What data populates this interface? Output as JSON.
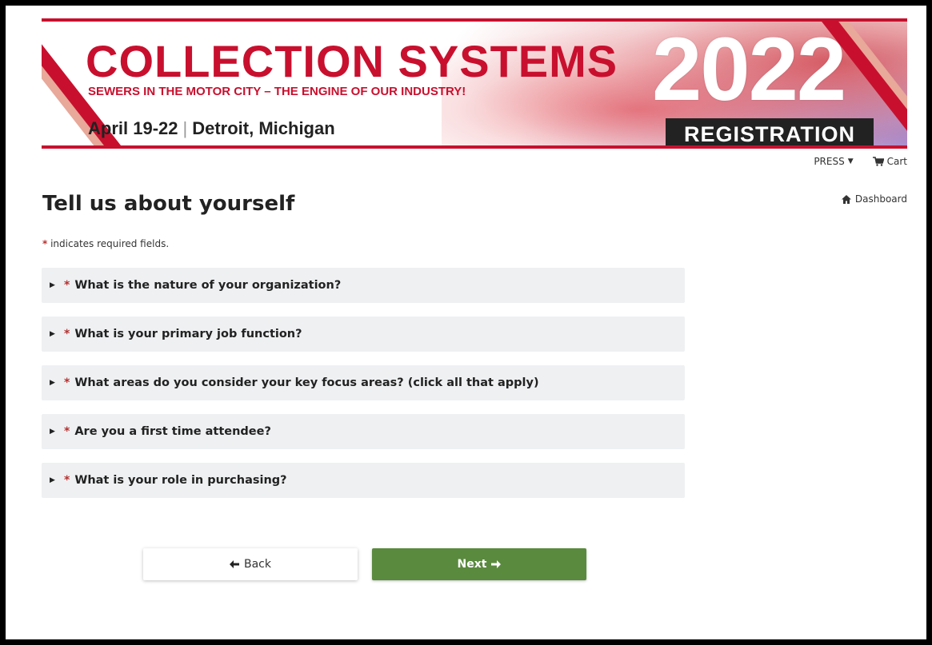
{
  "banner": {
    "title": "COLLECTION SYSTEMS",
    "tagline": "SEWERS IN THE MOTOR CITY – THE ENGINE OF OUR INDUSTRY!",
    "dates": "April 19-22",
    "location": "Detroit, Michigan",
    "year": "2022",
    "badge": "REGISTRATION"
  },
  "nav": {
    "press_label": "PRESS",
    "cart_label": "Cart",
    "dashboard_label": "Dashboard"
  },
  "page": {
    "heading": "Tell us about yourself",
    "required_star": "*",
    "required_note": " indicates required fields."
  },
  "questions": [
    {
      "label": "What is the nature of your organization?"
    },
    {
      "label": "What is your primary job function?"
    },
    {
      "label": "What areas do you consider your key focus areas? (click all that apply)"
    },
    {
      "label": "Are you a first time attendee?"
    },
    {
      "label": "What is your role in purchasing?"
    }
  ],
  "buttons": {
    "back_label": "Back",
    "next_label": "Next"
  },
  "colors": {
    "brand_red": "#c8102e",
    "required_star": "#b5312f",
    "next_button": "#5a8a3e",
    "question_bg": "#eef0f2"
  }
}
